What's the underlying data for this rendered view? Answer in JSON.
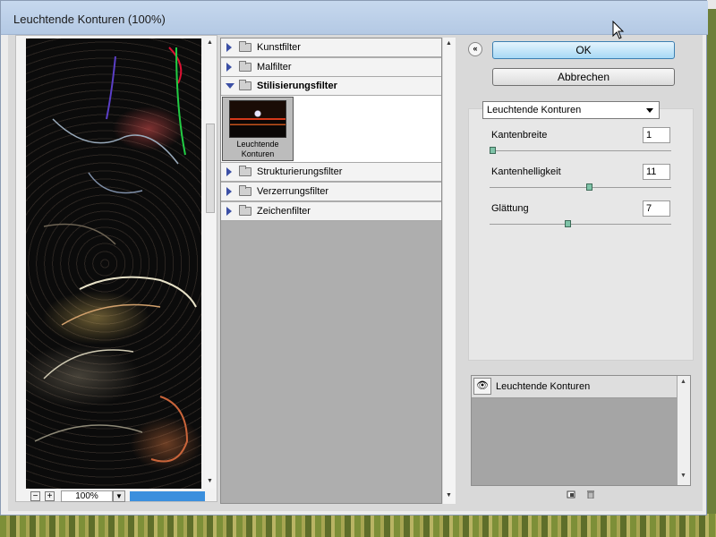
{
  "window": {
    "title": "Leuchtende Konturen (100%)"
  },
  "preview": {
    "zoom": "100%",
    "zoom_out_label": "−",
    "zoom_in_label": "+"
  },
  "filter_categories": [
    {
      "label": "Kunstfilter",
      "expanded": false
    },
    {
      "label": "Malfilter",
      "expanded": false
    },
    {
      "label": "Stilisierungsfilter",
      "expanded": true
    },
    {
      "label": "Strukturierungsfilter",
      "expanded": false
    },
    {
      "label": "Verzerrungsfilter",
      "expanded": false
    },
    {
      "label": "Zeichenfilter",
      "expanded": false
    }
  ],
  "selected_filter_thumb": {
    "label_line1": "Leuchtende",
    "label_line2": "Konturen"
  },
  "buttons": {
    "ok": "OK",
    "cancel": "Abbrechen",
    "collapse": "«"
  },
  "filter_select": {
    "value": "Leuchtende Konturen"
  },
  "params": [
    {
      "label": "Kantenbreite",
      "value": "1",
      "fraction": 0.0
    },
    {
      "label": "Kantenhelligkeit",
      "value": "11",
      "fraction": 0.55
    },
    {
      "label": "Glättung",
      "value": "7",
      "fraction": 0.43
    }
  ],
  "layers": [
    {
      "label": "Leuchtende Konturen",
      "icon": "eye-icon"
    }
  ],
  "colors": {
    "ok_button": "#a7d9f5",
    "progress": "#3b8fdd",
    "slider_handle": "#7fc3a8"
  }
}
